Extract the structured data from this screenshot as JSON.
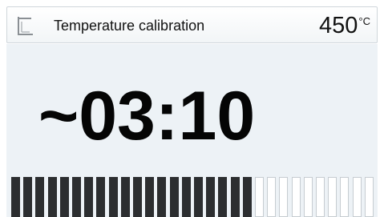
{
  "header": {
    "icon": "calibration-icon",
    "title": "Temperature calibration",
    "temperature": "450",
    "temperature_unit": "°C"
  },
  "timer": {
    "display": "~03:10"
  },
  "progress": {
    "total_segments": 30,
    "filled_segments": 20,
    "fraction": 0.667
  },
  "colors": {
    "background": "#edf2f6",
    "filled_segment": "#2c2e30",
    "empty_segment": "#ffffff",
    "text": "#050505"
  }
}
